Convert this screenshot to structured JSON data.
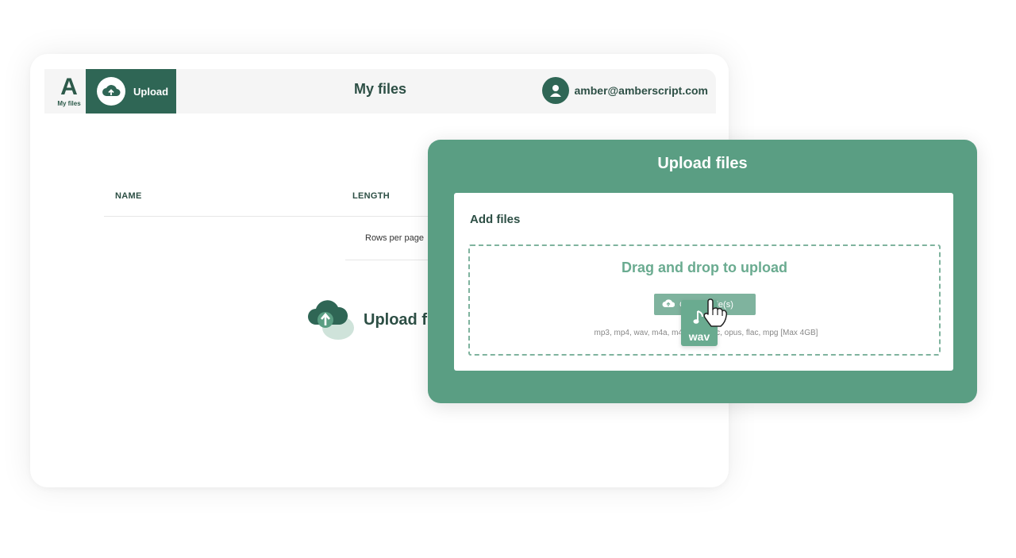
{
  "app": {
    "logo": {
      "letter": "A",
      "caption": "My files"
    },
    "nav": {
      "upload_label": "Upload"
    },
    "page_title": "My files",
    "user": {
      "email": "amber@amberscript.com"
    },
    "table": {
      "columns": [
        "NAME",
        "LENGTH"
      ],
      "rows_per_page_label": "Rows per page"
    },
    "empty_state": {
      "upload_label": "Upload fil"
    }
  },
  "modal": {
    "title": "Upload files",
    "section_title": "Add files",
    "dropzone": {
      "heading": "Drag and drop to upload",
      "button_label": "Choose file(s)",
      "formats": "mp3, mp4, wav, m4a, m4v, m…   aac, opus, flac, mpg [Max 4GB]"
    },
    "dragged_file": {
      "extension": "wav",
      "icon": "music-note-icon"
    }
  },
  "colors": {
    "primary_dark": "#2f6655",
    "primary": "#5a9e83",
    "primary_light": "#7fb39e",
    "text_dark": "#2d4f45"
  }
}
